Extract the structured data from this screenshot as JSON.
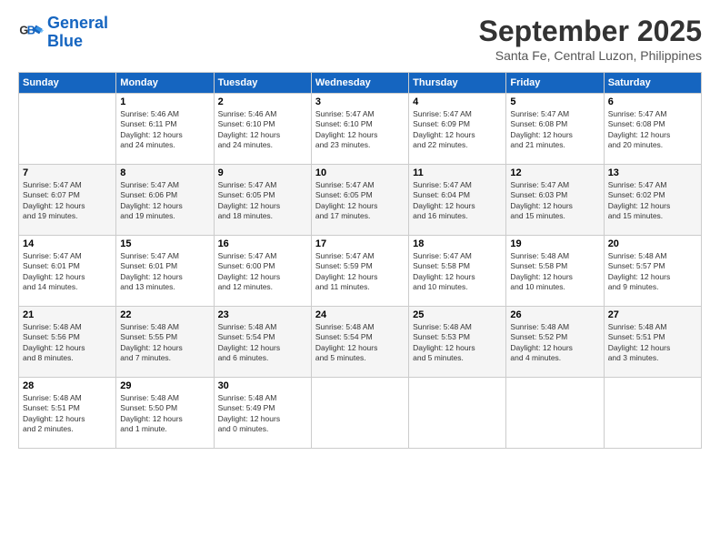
{
  "header": {
    "logo_line1": "General",
    "logo_line2": "Blue",
    "month": "September 2025",
    "location": "Santa Fe, Central Luzon, Philippines"
  },
  "days_of_week": [
    "Sunday",
    "Monday",
    "Tuesday",
    "Wednesday",
    "Thursday",
    "Friday",
    "Saturday"
  ],
  "weeks": [
    [
      {
        "day": "",
        "info": ""
      },
      {
        "day": "1",
        "info": "Sunrise: 5:46 AM\nSunset: 6:11 PM\nDaylight: 12 hours\nand 24 minutes."
      },
      {
        "day": "2",
        "info": "Sunrise: 5:46 AM\nSunset: 6:10 PM\nDaylight: 12 hours\nand 24 minutes."
      },
      {
        "day": "3",
        "info": "Sunrise: 5:47 AM\nSunset: 6:10 PM\nDaylight: 12 hours\nand 23 minutes."
      },
      {
        "day": "4",
        "info": "Sunrise: 5:47 AM\nSunset: 6:09 PM\nDaylight: 12 hours\nand 22 minutes."
      },
      {
        "day": "5",
        "info": "Sunrise: 5:47 AM\nSunset: 6:08 PM\nDaylight: 12 hours\nand 21 minutes."
      },
      {
        "day": "6",
        "info": "Sunrise: 5:47 AM\nSunset: 6:08 PM\nDaylight: 12 hours\nand 20 minutes."
      }
    ],
    [
      {
        "day": "7",
        "info": "Sunrise: 5:47 AM\nSunset: 6:07 PM\nDaylight: 12 hours\nand 19 minutes."
      },
      {
        "day": "8",
        "info": "Sunrise: 5:47 AM\nSunset: 6:06 PM\nDaylight: 12 hours\nand 19 minutes."
      },
      {
        "day": "9",
        "info": "Sunrise: 5:47 AM\nSunset: 6:05 PM\nDaylight: 12 hours\nand 18 minutes."
      },
      {
        "day": "10",
        "info": "Sunrise: 5:47 AM\nSunset: 6:05 PM\nDaylight: 12 hours\nand 17 minutes."
      },
      {
        "day": "11",
        "info": "Sunrise: 5:47 AM\nSunset: 6:04 PM\nDaylight: 12 hours\nand 16 minutes."
      },
      {
        "day": "12",
        "info": "Sunrise: 5:47 AM\nSunset: 6:03 PM\nDaylight: 12 hours\nand 15 minutes."
      },
      {
        "day": "13",
        "info": "Sunrise: 5:47 AM\nSunset: 6:02 PM\nDaylight: 12 hours\nand 15 minutes."
      }
    ],
    [
      {
        "day": "14",
        "info": "Sunrise: 5:47 AM\nSunset: 6:01 PM\nDaylight: 12 hours\nand 14 minutes."
      },
      {
        "day": "15",
        "info": "Sunrise: 5:47 AM\nSunset: 6:01 PM\nDaylight: 12 hours\nand 13 minutes."
      },
      {
        "day": "16",
        "info": "Sunrise: 5:47 AM\nSunset: 6:00 PM\nDaylight: 12 hours\nand 12 minutes."
      },
      {
        "day": "17",
        "info": "Sunrise: 5:47 AM\nSunset: 5:59 PM\nDaylight: 12 hours\nand 11 minutes."
      },
      {
        "day": "18",
        "info": "Sunrise: 5:47 AM\nSunset: 5:58 PM\nDaylight: 12 hours\nand 10 minutes."
      },
      {
        "day": "19",
        "info": "Sunrise: 5:48 AM\nSunset: 5:58 PM\nDaylight: 12 hours\nand 10 minutes."
      },
      {
        "day": "20",
        "info": "Sunrise: 5:48 AM\nSunset: 5:57 PM\nDaylight: 12 hours\nand 9 minutes."
      }
    ],
    [
      {
        "day": "21",
        "info": "Sunrise: 5:48 AM\nSunset: 5:56 PM\nDaylight: 12 hours\nand 8 minutes."
      },
      {
        "day": "22",
        "info": "Sunrise: 5:48 AM\nSunset: 5:55 PM\nDaylight: 12 hours\nand 7 minutes."
      },
      {
        "day": "23",
        "info": "Sunrise: 5:48 AM\nSunset: 5:54 PM\nDaylight: 12 hours\nand 6 minutes."
      },
      {
        "day": "24",
        "info": "Sunrise: 5:48 AM\nSunset: 5:54 PM\nDaylight: 12 hours\nand 5 minutes."
      },
      {
        "day": "25",
        "info": "Sunrise: 5:48 AM\nSunset: 5:53 PM\nDaylight: 12 hours\nand 5 minutes."
      },
      {
        "day": "26",
        "info": "Sunrise: 5:48 AM\nSunset: 5:52 PM\nDaylight: 12 hours\nand 4 minutes."
      },
      {
        "day": "27",
        "info": "Sunrise: 5:48 AM\nSunset: 5:51 PM\nDaylight: 12 hours\nand 3 minutes."
      }
    ],
    [
      {
        "day": "28",
        "info": "Sunrise: 5:48 AM\nSunset: 5:51 PM\nDaylight: 12 hours\nand 2 minutes."
      },
      {
        "day": "29",
        "info": "Sunrise: 5:48 AM\nSunset: 5:50 PM\nDaylight: 12 hours\nand 1 minute."
      },
      {
        "day": "30",
        "info": "Sunrise: 5:48 AM\nSunset: 5:49 PM\nDaylight: 12 hours\nand 0 minutes."
      },
      {
        "day": "",
        "info": ""
      },
      {
        "day": "",
        "info": ""
      },
      {
        "day": "",
        "info": ""
      },
      {
        "day": "",
        "info": ""
      }
    ]
  ]
}
